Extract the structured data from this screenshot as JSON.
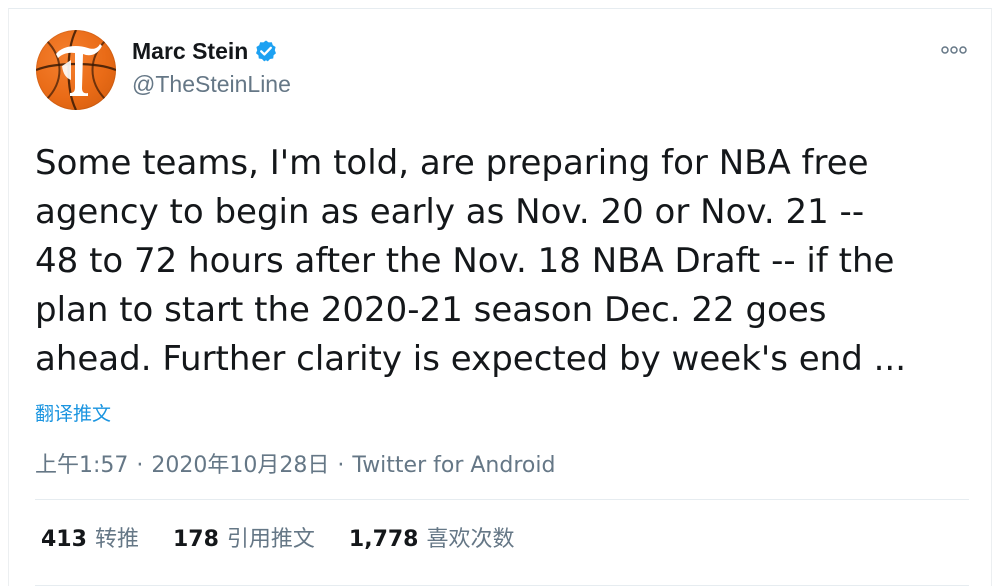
{
  "user": {
    "display_name": "Marc Stein",
    "handle": "@TheSteinLine",
    "verified": true,
    "avatar_icon": "nyt-basketball-logo-icon",
    "accent_color": "#1da1f2"
  },
  "tweet": {
    "text": "Some teams, I'm told, are preparing for NBA free\nagency to begin as early as Nov. 20 or Nov. 21 --\n48 to 72 hours after the Nov. 18 NBA Draft -- if the\nplan to start the 2020-21 season Dec. 22 goes\nahead. Further clarity is expected by week's end ...",
    "translate_label": "翻译推文"
  },
  "meta": {
    "time": "上午1:57",
    "separator": "·",
    "date": "2020年10月28日",
    "source": "Twitter for Android"
  },
  "stats": {
    "retweets_count": "413",
    "retweets_label": "转推",
    "quotes_count": "178",
    "quotes_label": "引用推文",
    "likes_count": "1,778",
    "likes_label": "喜欢次数"
  },
  "icons": {
    "more": "more-options-icon",
    "verified": "verified-badge-icon"
  }
}
